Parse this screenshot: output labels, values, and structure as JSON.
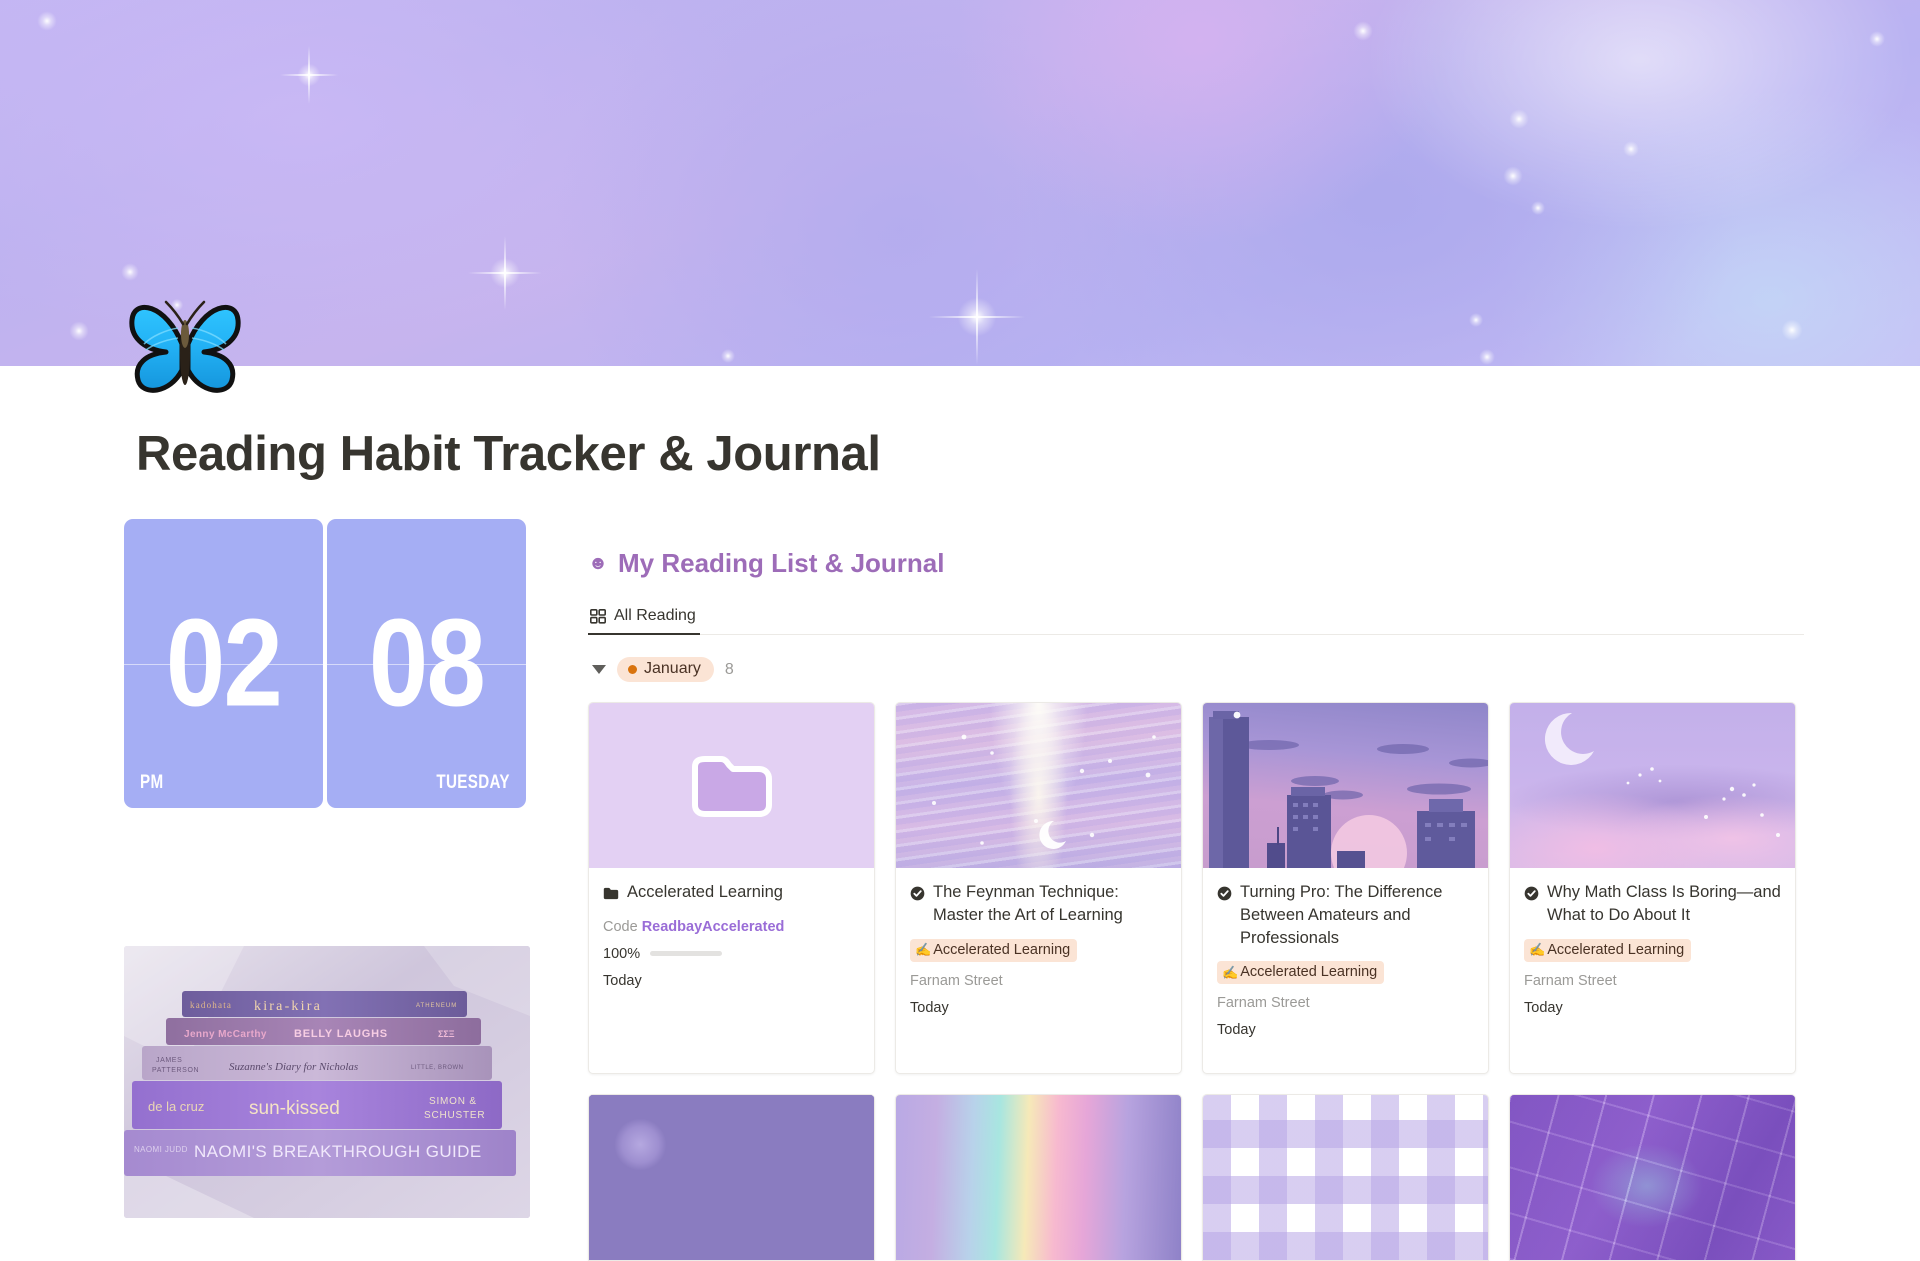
{
  "page": {
    "icon": "butterfly-emoji",
    "title": "Reading Habit Tracker & Journal"
  },
  "banner": {
    "name": "purple-sky-clouds-banner"
  },
  "clock": {
    "hour": "02",
    "minute": "08",
    "meridiem": "PM",
    "weekday": "TUESDAY"
  },
  "sidebar_image": {
    "name": "purple-book-stack-photo",
    "books": [
      "kadohata  kira-kira  ATHENEUM",
      "Jenny McCarthy  BELLY LAUGHS",
      "JAMES PATTERSON  Suzanne's Diary for Nicholas  LITTLE, BROWN",
      "de la cruz  sun-kissed  SIMON & SCHUSTER",
      "NAOMI JUDD  NAOMI'S BREAKTHROUGH GUIDE"
    ]
  },
  "database": {
    "icon": "smiley-icon",
    "title": "My Reading  List & Journal",
    "tabs": [
      {
        "label": "All Reading",
        "icon": "grid-gallery-icon",
        "active": true
      }
    ],
    "group": {
      "collapsed": false,
      "label": "January",
      "count": "8",
      "dot_color": "#d9730d",
      "pill_bg": "#fbe4d5"
    },
    "cards": [
      {
        "thumb": "folder-placeholder",
        "icon": "folder-icon",
        "title": "Accelerated Learning",
        "code_label": "Code",
        "code_value": "ReadbayAccelerated",
        "percent": "100%",
        "percent_value": 100,
        "date": "Today"
      },
      {
        "thumb": "shimmering-water-moonlight",
        "icon": "check-circle-icon",
        "title": "The Feynman Technique: Master the Art of Learning",
        "tag": "Accelerated Learning",
        "tag_icon": "writing-hand-icon",
        "source": "Farnam Street",
        "date": "Today"
      },
      {
        "thumb": "purple-city-skyline-sunset",
        "icon": "check-circle-icon",
        "title": "Turning Pro: The Difference Between Amateurs and Professionals",
        "tag": "Accelerated Learning",
        "tag_icon": "writing-hand-icon",
        "source": "Farnam Street",
        "date": "Today"
      },
      {
        "thumb": "crescent-moon-lavender-clouds",
        "icon": "check-circle-icon",
        "title": "Why Math Class Is Boring—and What to Do About It",
        "tag": "Accelerated Learning",
        "tag_icon": "writing-hand-icon",
        "source": "Farnam Street",
        "date": "Today"
      }
    ],
    "cards_row2": [
      {
        "thumb": "purple-candy-buttons"
      },
      {
        "thumb": "rainbow-gradient"
      },
      {
        "thumb": "lavender-gingham-check"
      },
      {
        "thumb": "purple-keyboard-closeup"
      }
    ]
  },
  "colors": {
    "accent_purple": "#9a6dd7",
    "title_purple": "#9d6cb8",
    "clock_blue": "#a5aef4",
    "tag_bg": "#fbe4d5",
    "tag_text": "#4a3224",
    "text_primary": "#37352f",
    "text_muted": "#9b9a97"
  }
}
